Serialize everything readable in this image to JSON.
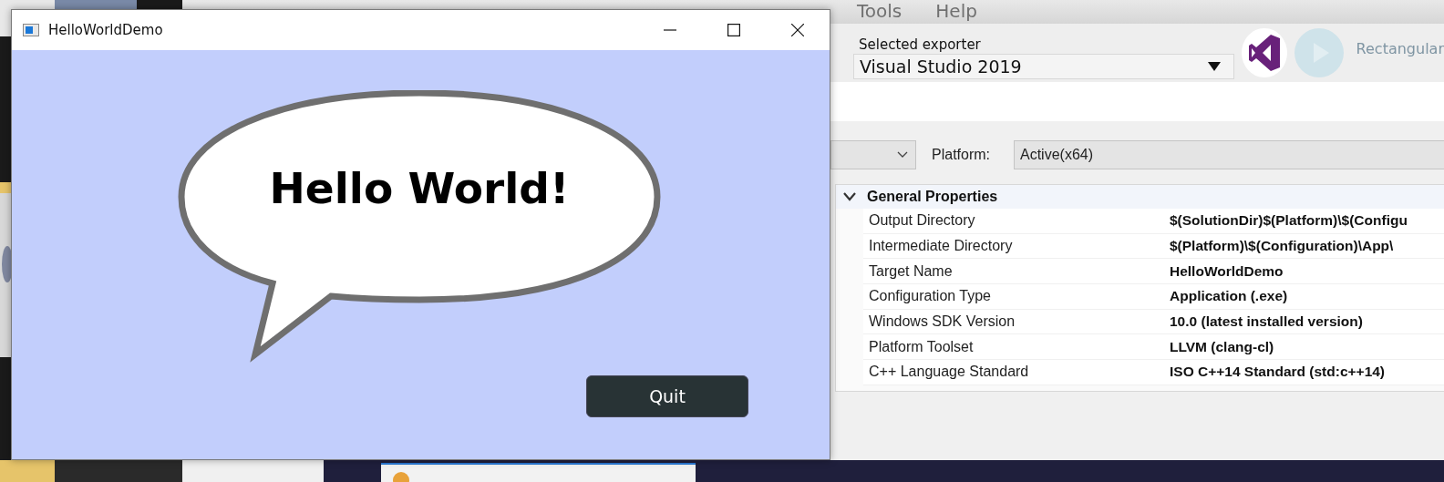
{
  "background_app": {
    "menu": [
      "Tools",
      "Help"
    ],
    "exporter": {
      "label": "Selected exporter",
      "value": "Visual Studio 2019"
    },
    "faded_button": "Rectangular",
    "platform": {
      "label": "Platform:",
      "value": "Active(x64)"
    },
    "property_group": {
      "title": "General Properties",
      "expanded": true,
      "properties": [
        {
          "name": "Output Directory",
          "value": "$(SolutionDir)$(Platform)\\$(Configu"
        },
        {
          "name": "Intermediate Directory",
          "value": "$(Platform)\\$(Configuration)\\App\\"
        },
        {
          "name": "Target Name",
          "value": "HelloWorldDemo"
        },
        {
          "name": "Configuration Type",
          "value": "Application (.exe)"
        },
        {
          "name": "Windows SDK Version",
          "value": "10.0 (latest installed version)"
        },
        {
          "name": "Platform Toolset",
          "value": "LLVM (clang-cl)"
        },
        {
          "name": "C++ Language Standard",
          "value": "ISO C++14 Standard (std:c++14)"
        }
      ]
    }
  },
  "app_window": {
    "title": "HelloWorldDemo",
    "greeting": "Hello World!",
    "button": "Quit"
  }
}
